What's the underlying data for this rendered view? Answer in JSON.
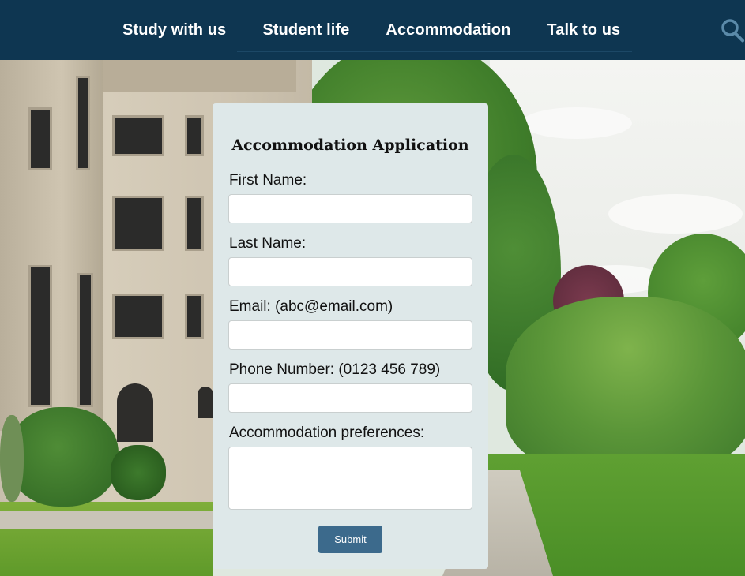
{
  "nav": {
    "items": [
      {
        "label": "Study with us"
      },
      {
        "label": "Student life"
      },
      {
        "label": "Accommodation"
      },
      {
        "label": "Talk to us"
      }
    ],
    "search_icon": "search-icon"
  },
  "form": {
    "title": "Accommodation Application",
    "fields": [
      {
        "label": "First Name:",
        "value": ""
      },
      {
        "label": "Last Name:",
        "value": ""
      },
      {
        "label": "Email: (abc@email.com)",
        "value": ""
      },
      {
        "label": "Phone Number: (0123 456 789)",
        "value": ""
      },
      {
        "label": "Accommodation preferences:",
        "value": ""
      }
    ],
    "submit_label": "Submit"
  },
  "colors": {
    "nav_bg": "#0e3651",
    "card_bg": "#dee8e9",
    "submit_bg": "#3c6a8c",
    "search_icon": "#5b8aa9"
  }
}
